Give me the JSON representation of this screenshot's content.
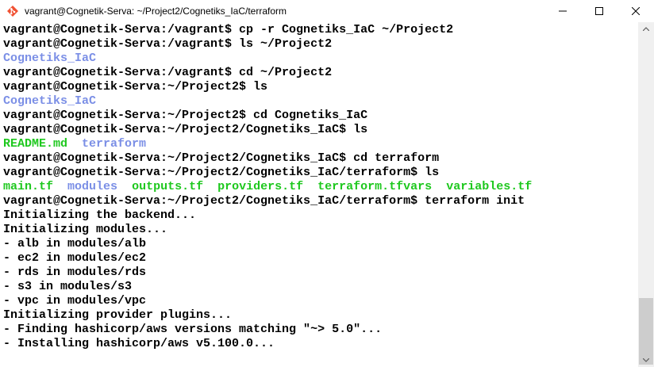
{
  "window": {
    "title": "vagrant@Cognetik-Serva: ~/Project2/Cognetiks_IaC/terraform",
    "icon": "git-bash-icon"
  },
  "colors": {
    "directory": "#7b8fe6",
    "file": "#1ec81e",
    "text": "#000000",
    "background": "#ffffff"
  },
  "terminal": {
    "lines": [
      [
        {
          "t": "vagrant@Cognetik-Serva:/vagrant$ cp -r Cognetiks_IaC ~/Project2",
          "c": "text"
        }
      ],
      [
        {
          "t": "vagrant@Cognetik-Serva:/vagrant$ ls ~/Project2",
          "c": "text"
        }
      ],
      [
        {
          "t": "Cognetiks_IaC",
          "c": "dir"
        }
      ],
      [
        {
          "t": "vagrant@Cognetik-Serva:/vagrant$ cd ~/Project2",
          "c": "text"
        }
      ],
      [
        {
          "t": "vagrant@Cognetik-Serva:~/Project2$ ls",
          "c": "text"
        }
      ],
      [
        {
          "t": "Cognetiks_IaC",
          "c": "dir"
        }
      ],
      [
        {
          "t": "vagrant@Cognetik-Serva:~/Project2$ cd Cognetiks_IaC",
          "c": "text"
        }
      ],
      [
        {
          "t": "vagrant@Cognetik-Serva:~/Project2/Cognetiks_IaC$ ls",
          "c": "text"
        }
      ],
      [
        {
          "t": "README.md",
          "c": "file"
        },
        {
          "t": "  ",
          "c": "text"
        },
        {
          "t": "terraform",
          "c": "dir"
        }
      ],
      [
        {
          "t": "vagrant@Cognetik-Serva:~/Project2/Cognetiks_IaC$ cd terraform",
          "c": "text"
        }
      ],
      [
        {
          "t": "vagrant@Cognetik-Serva:~/Project2/Cognetiks_IaC/terraform$ ls",
          "c": "text"
        }
      ],
      [
        {
          "t": "main.tf",
          "c": "file"
        },
        {
          "t": "  ",
          "c": "text"
        },
        {
          "t": "modules",
          "c": "dir"
        },
        {
          "t": "  ",
          "c": "text"
        },
        {
          "t": "outputs.tf",
          "c": "file"
        },
        {
          "t": "  ",
          "c": "text"
        },
        {
          "t": "providers.tf",
          "c": "file"
        },
        {
          "t": "  ",
          "c": "text"
        },
        {
          "t": "terraform.tfvars",
          "c": "file"
        },
        {
          "t": "  ",
          "c": "text"
        },
        {
          "t": "variables.tf",
          "c": "file"
        }
      ],
      [
        {
          "t": "vagrant@Cognetik-Serva:~/Project2/Cognetiks_IaC/terraform$ terraform init",
          "c": "text"
        }
      ],
      [
        {
          "t": "Initializing the backend...",
          "c": "text"
        }
      ],
      [
        {
          "t": "Initializing modules...",
          "c": "text"
        }
      ],
      [
        {
          "t": "- alb in modules/alb",
          "c": "text"
        }
      ],
      [
        {
          "t": "- ec2 in modules/ec2",
          "c": "text"
        }
      ],
      [
        {
          "t": "- rds in modules/rds",
          "c": "text"
        }
      ],
      [
        {
          "t": "- s3 in modules/s3",
          "c": "text"
        }
      ],
      [
        {
          "t": "- vpc in modules/vpc",
          "c": "text"
        }
      ],
      [
        {
          "t": "Initializing provider plugins...",
          "c": "text"
        }
      ],
      [
        {
          "t": "- Finding hashicorp/aws versions matching \"~> 5.0\"...",
          "c": "text"
        }
      ],
      [
        {
          "t": "- Installing hashicorp/aws v5.100.0...",
          "c": "text"
        }
      ]
    ]
  }
}
